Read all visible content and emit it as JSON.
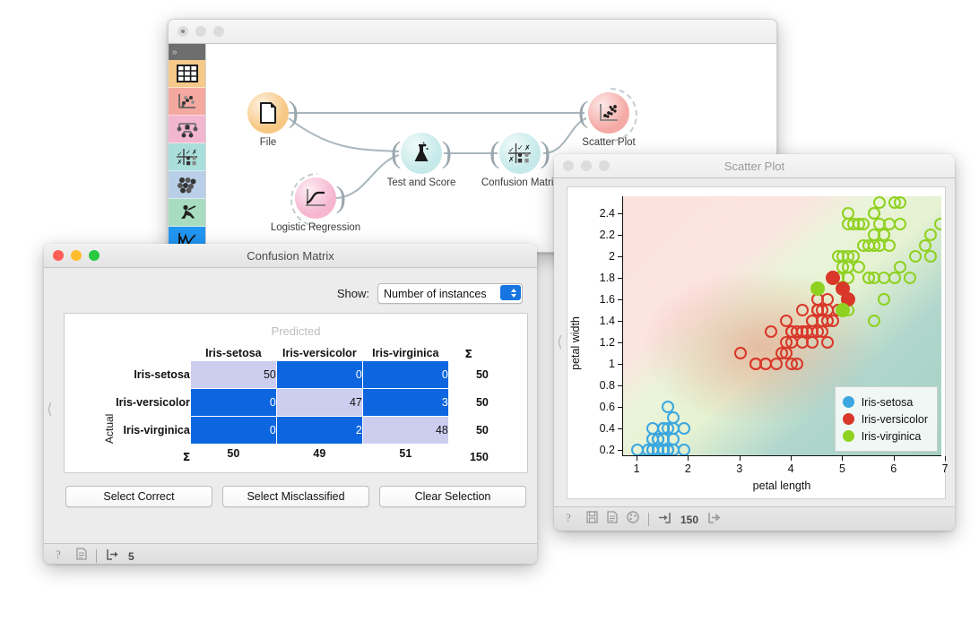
{
  "main_window": {
    "title": "",
    "toolbox": {
      "expand_label": "»",
      "items": [
        {
          "name": "data-table-widget",
          "color": "#f5c98a"
        },
        {
          "name": "scatter-plot-widget",
          "color": "#f3a8a0"
        },
        {
          "name": "tree-widget",
          "color": "#f3b6cf"
        },
        {
          "name": "confusion-matrix-widget",
          "color": "#a9dedb"
        },
        {
          "name": "cluster-widget",
          "color": "#b9cfe8"
        },
        {
          "name": "unsupervised-widget",
          "color": "#a8dcc0"
        },
        {
          "name": "line-plot-widget",
          "color": "#2196f3"
        }
      ]
    },
    "nodes": [
      {
        "label": "File",
        "color": "#f7c884",
        "icon": "document-icon"
      },
      {
        "label": "Logistic Regression",
        "color": "#f6b6cf",
        "icon": "sigmoid-curve-icon"
      },
      {
        "label": "Test and Score",
        "color": "#c6eaea",
        "icon": "flask-icon"
      },
      {
        "label": "Confusion Matrix",
        "color": "#c6eaea",
        "icon": "matrix-icon"
      },
      {
        "label": "Scatter Plot",
        "color": "#f5aaa6",
        "icon": "scatter-icon"
      }
    ]
  },
  "confusion_matrix": {
    "title": "Confusion Matrix",
    "show_label": "Show:",
    "show_value": "Number of instances",
    "predicted_label": "Predicted",
    "actual_label": "Actual",
    "sigma": "Σ",
    "col_headers": [
      "Iris-setosa",
      "Iris-versicolor",
      "Iris-virginica"
    ],
    "row_headers": [
      "Iris-setosa",
      "Iris-versicolor",
      "Iris-virginica"
    ],
    "cells": [
      [
        {
          "v": "50",
          "t": "diag"
        },
        {
          "v": "0",
          "t": "off"
        },
        {
          "v": "0",
          "t": "off"
        }
      ],
      [
        {
          "v": "0",
          "t": "off"
        },
        {
          "v": "47",
          "t": "diag"
        },
        {
          "v": "3",
          "t": "off"
        }
      ],
      [
        {
          "v": "0",
          "t": "off"
        },
        {
          "v": "2",
          "t": "off"
        },
        {
          "v": "48",
          "t": "diag"
        }
      ]
    ],
    "row_totals": [
      "50",
      "50",
      "50"
    ],
    "col_totals": [
      "50",
      "49",
      "51"
    ],
    "grand_total": "150",
    "buttons": [
      "Select Correct",
      "Select Misclassified",
      "Clear Selection"
    ],
    "status": {
      "output_count": "5"
    },
    "colors": {
      "diagonal": "#cdcdf0",
      "off_diagonal": "#0d66e0"
    }
  },
  "scatter_plot": {
    "title": "Scatter Plot",
    "status": {
      "input_count": "150"
    },
    "chart_data": {
      "type": "scatter",
      "title": "Scatter Plot",
      "xlabel": "petal length",
      "ylabel": "petal width",
      "xlim": [
        0.72,
        7.12
      ],
      "ylim": [
        0.04,
        2.56
      ],
      "xticks": [
        1,
        2,
        3,
        4,
        5,
        6,
        7
      ],
      "yticks": [
        0.2,
        0.4,
        0.6,
        0.8,
        1,
        1.2,
        1.4,
        1.6,
        1.8,
        2,
        2.2,
        2.4
      ],
      "grid": false,
      "legend_position": "bottom-right",
      "background": "logistic-regression decision probability field (blue / red / green)",
      "series": [
        {
          "name": "Iris-setosa",
          "color": "#3ba7e0",
          "points": [
            [
              1.4,
              0.2
            ],
            [
              1.4,
              0.2
            ],
            [
              1.3,
              0.2
            ],
            [
              1.5,
              0.2
            ],
            [
              1.4,
              0.2
            ],
            [
              1.7,
              0.4
            ],
            [
              1.4,
              0.3
            ],
            [
              1.5,
              0.2
            ],
            [
              1.4,
              0.2
            ],
            [
              1.5,
              0.1
            ],
            [
              1.5,
              0.2
            ],
            [
              1.6,
              0.2
            ],
            [
              1.4,
              0.1
            ],
            [
              1.1,
              0.1
            ],
            [
              1.2,
              0.2
            ],
            [
              1.5,
              0.4
            ],
            [
              1.3,
              0.4
            ],
            [
              1.4,
              0.3
            ],
            [
              1.7,
              0.3
            ],
            [
              1.5,
              0.3
            ],
            [
              1.7,
              0.2
            ],
            [
              1.5,
              0.4
            ],
            [
              1.0,
              0.2
            ],
            [
              1.7,
              0.5
            ],
            [
              1.9,
              0.2
            ],
            [
              1.6,
              0.2
            ],
            [
              1.6,
              0.4
            ],
            [
              1.5,
              0.2
            ],
            [
              1.4,
              0.2
            ],
            [
              1.6,
              0.2
            ],
            [
              1.6,
              0.2
            ],
            [
              1.5,
              0.4
            ],
            [
              1.5,
              0.1
            ],
            [
              1.4,
              0.2
            ],
            [
              1.5,
              0.2
            ],
            [
              1.2,
              0.2
            ],
            [
              1.3,
              0.2
            ],
            [
              1.4,
              0.1
            ],
            [
              1.3,
              0.2
            ],
            [
              1.5,
              0.2
            ],
            [
              1.3,
              0.3
            ],
            [
              1.3,
              0.3
            ],
            [
              1.3,
              0.2
            ],
            [
              1.6,
              0.6
            ],
            [
              1.9,
              0.4
            ],
            [
              1.4,
              0.3
            ],
            [
              1.6,
              0.2
            ],
            [
              1.4,
              0.2
            ],
            [
              1.5,
              0.2
            ],
            [
              1.4,
              0.2
            ]
          ]
        },
        {
          "name": "Iris-versicolor",
          "color": "#d9372a",
          "points": [
            [
              4.7,
              1.4
            ],
            [
              4.5,
              1.5
            ],
            [
              4.9,
              1.5
            ],
            [
              4.0,
              1.3
            ],
            [
              4.6,
              1.5
            ],
            [
              4.5,
              1.3
            ],
            [
              4.7,
              1.6
            ],
            [
              3.3,
              1.0
            ],
            [
              4.6,
              1.3
            ],
            [
              3.9,
              1.4
            ],
            [
              3.5,
              1.0
            ],
            [
              4.2,
              1.5
            ],
            [
              4.0,
              1.0
            ],
            [
              4.7,
              1.4
            ],
            [
              3.6,
              1.3
            ],
            [
              4.4,
              1.4
            ],
            [
              4.5,
              1.5
            ],
            [
              4.1,
              1.0
            ],
            [
              4.5,
              1.5
            ],
            [
              3.9,
              1.1
            ],
            [
              4.8,
              1.8
            ],
            [
              4.0,
              1.3
            ],
            [
              4.9,
              1.5
            ],
            [
              4.7,
              1.2
            ],
            [
              4.3,
              1.3
            ],
            [
              4.4,
              1.4
            ],
            [
              4.8,
              1.4
            ],
            [
              5.0,
              1.7
            ],
            [
              4.5,
              1.5
            ],
            [
              3.5,
              1.0
            ],
            [
              3.8,
              1.1
            ],
            [
              3.7,
              1.0
            ],
            [
              3.9,
              1.2
            ],
            [
              5.1,
              1.6
            ],
            [
              4.5,
              1.5
            ],
            [
              4.5,
              1.6
            ],
            [
              4.7,
              1.5
            ],
            [
              4.4,
              1.3
            ],
            [
              4.1,
              1.3
            ],
            [
              4.0,
              1.3
            ],
            [
              4.4,
              1.2
            ],
            [
              4.6,
              1.4
            ],
            [
              4.0,
              1.2
            ],
            [
              3.3,
              1.0
            ],
            [
              4.2,
              1.3
            ],
            [
              4.2,
              1.2
            ],
            [
              4.2,
              1.3
            ],
            [
              4.3,
              1.3
            ],
            [
              3.0,
              1.1
            ],
            [
              4.1,
              1.3
            ]
          ]
        },
        {
          "name": "Iris-virginica",
          "color": "#8fd120",
          "points": [
            [
              6.0,
              2.5
            ],
            [
              5.1,
              1.9
            ],
            [
              5.9,
              2.1
            ],
            [
              5.6,
              1.8
            ],
            [
              5.8,
              2.2
            ],
            [
              6.6,
              2.1
            ],
            [
              4.5,
              1.7
            ],
            [
              6.3,
              1.8
            ],
            [
              5.8,
              1.8
            ],
            [
              6.1,
              2.5
            ],
            [
              5.1,
              2.0
            ],
            [
              5.3,
              1.9
            ],
            [
              5.5,
              2.1
            ],
            [
              5.0,
              2.0
            ],
            [
              5.1,
              2.4
            ],
            [
              5.3,
              2.3
            ],
            [
              5.5,
              1.8
            ],
            [
              6.7,
              2.2
            ],
            [
              6.9,
              2.3
            ],
            [
              5.0,
              1.5
            ],
            [
              5.7,
              2.3
            ],
            [
              4.9,
              2.0
            ],
            [
              6.7,
              2.0
            ],
            [
              4.9,
              1.8
            ],
            [
              5.7,
              2.1
            ],
            [
              6.0,
              1.8
            ],
            [
              4.8,
              1.8
            ],
            [
              4.9,
              1.8
            ],
            [
              5.6,
              2.1
            ],
            [
              5.8,
              1.6
            ],
            [
              6.1,
              1.9
            ],
            [
              6.4,
              2.0
            ],
            [
              5.6,
              2.2
            ],
            [
              5.1,
              1.5
            ],
            [
              5.6,
              1.4
            ],
            [
              6.1,
              2.3
            ],
            [
              5.6,
              2.4
            ],
            [
              5.5,
              1.8
            ],
            [
              4.8,
              1.8
            ],
            [
              5.4,
              2.1
            ],
            [
              5.6,
              2.4
            ],
            [
              5.1,
              2.3
            ],
            [
              5.1,
              1.9
            ],
            [
              5.9,
              2.3
            ],
            [
              5.7,
              2.5
            ],
            [
              5.2,
              2.3
            ],
            [
              5.0,
              1.9
            ],
            [
              5.2,
              2.0
            ],
            [
              5.4,
              2.3
            ],
            [
              5.1,
              1.8
            ]
          ]
        }
      ],
      "highlighted_points": [
        {
          "x": 4.8,
          "y": 1.8,
          "color": "#d9372a"
        },
        {
          "x": 5.0,
          "y": 1.7,
          "color": "#d9372a"
        },
        {
          "x": 5.1,
          "y": 1.6,
          "color": "#d9372a"
        },
        {
          "x": 4.5,
          "y": 1.7,
          "color": "#8fd120"
        },
        {
          "x": 5.0,
          "y": 1.5,
          "color": "#8fd120"
        }
      ],
      "legend": [
        {
          "label": "Iris-setosa",
          "color": "#3ba7e0"
        },
        {
          "label": "Iris-versicolor",
          "color": "#d9372a"
        },
        {
          "label": "Iris-virginica",
          "color": "#8fd120"
        }
      ]
    }
  }
}
